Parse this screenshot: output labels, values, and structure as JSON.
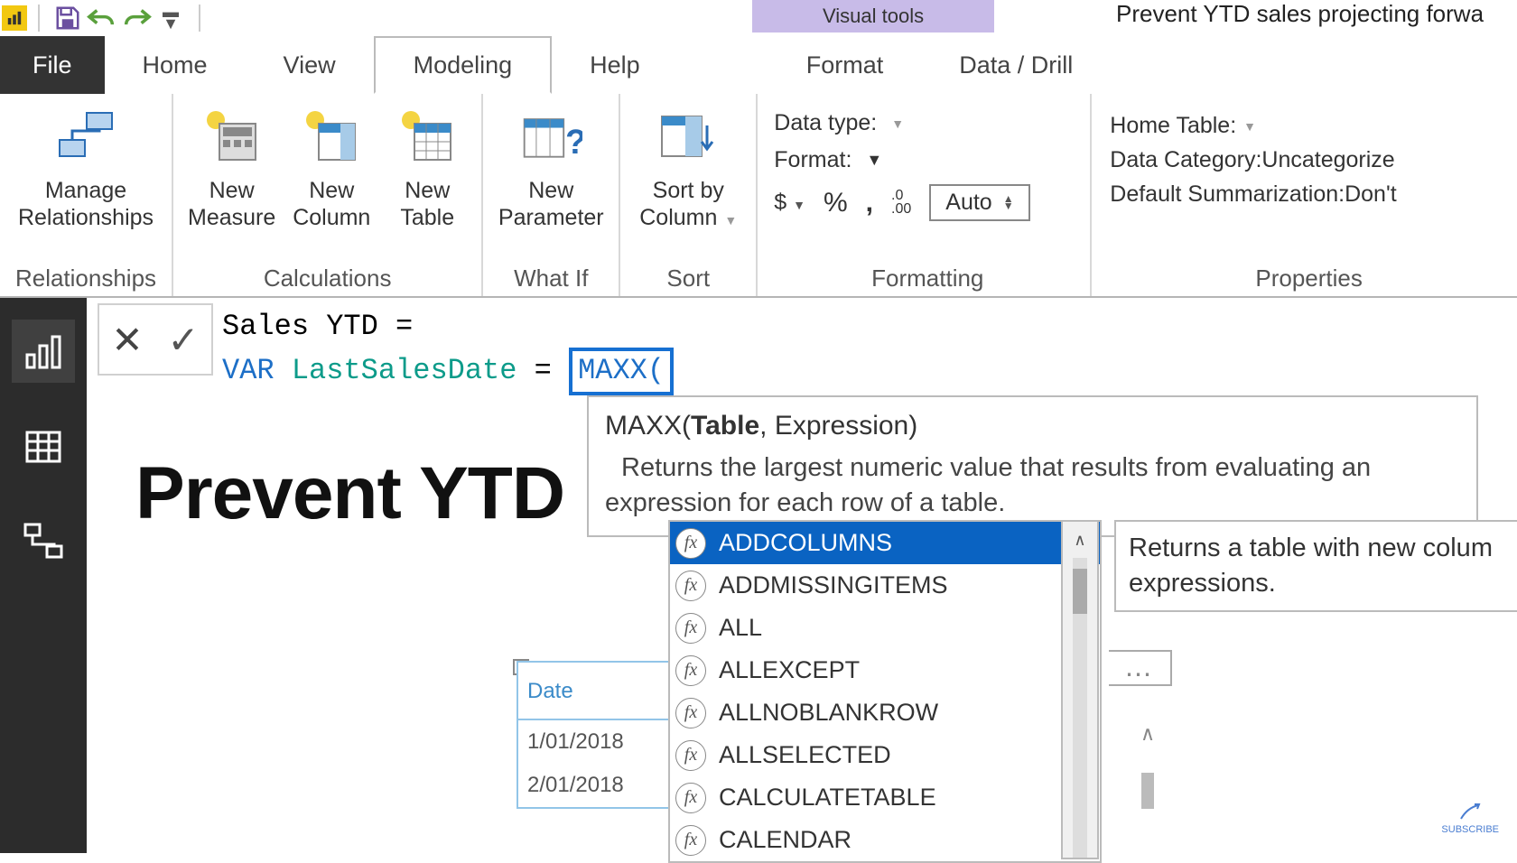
{
  "app": {
    "contextual_tab_group": "Visual tools",
    "window_title": "Prevent YTD sales projecting forwa"
  },
  "qat": {
    "save": "Save",
    "undo": "Undo",
    "redo": "Redo"
  },
  "tabs": {
    "file": "File",
    "home": "Home",
    "view": "View",
    "modeling": "Modeling",
    "help": "Help",
    "format": "Format",
    "datadrill": "Data / Drill"
  },
  "ribbon": {
    "relationships": {
      "manage": "Manage\nRelationships",
      "group": "Relationships"
    },
    "calculations": {
      "measure": "New\nMeasure",
      "column": "New\nColumn",
      "table": "New\nTable",
      "group": "Calculations"
    },
    "whatif": {
      "param": "New\nParameter",
      "group": "What If"
    },
    "sort": {
      "sortby": "Sort by\nColumn",
      "group": "Sort"
    },
    "formatting": {
      "datatype_lbl": "Data type:",
      "format_lbl": "Format:",
      "currency": "$",
      "percent": "%",
      "comma": ",",
      "decimals_icon": ".00",
      "auto": "Auto",
      "group": "Formatting"
    },
    "properties": {
      "hometable_lbl": "Home Table:",
      "datacat_lbl": "Data Category: ",
      "datacat_val": "Uncategorize",
      "defsum_lbl": "Default Summarization: ",
      "defsum_val": "Don't",
      "group": "Properties"
    }
  },
  "formula": {
    "line1_name": "Sales YTD",
    "line1_eq": " = ",
    "var_kw": "VAR",
    "var_name": "LastSalesDate",
    "eq2": " = ",
    "fn": "MAXX(",
    "tooltip_sig_fn": "MAXX(",
    "tooltip_sig_arg1": "Table",
    "tooltip_sig_rest": ", Expression)",
    "tooltip_desc": "Returns the largest numeric value that results from evaluating an expression for each row of a table."
  },
  "intellisense": {
    "items": [
      "ADDCOLUMNS",
      "ADDMISSINGITEMS",
      "ALL",
      "ALLEXCEPT",
      "ALLNOBLANKROW",
      "ALLSELECTED",
      "CALCULATETABLE",
      "CALENDAR"
    ],
    "selected": 0,
    "tip": "Returns a table with new colum expressions."
  },
  "canvas": {
    "heading": "Prevent YTD"
  },
  "date_table": {
    "header": "Date",
    "rows": [
      "1/01/2018",
      "2/01/2018"
    ]
  },
  "subscribe": "SUBSCRIBE"
}
